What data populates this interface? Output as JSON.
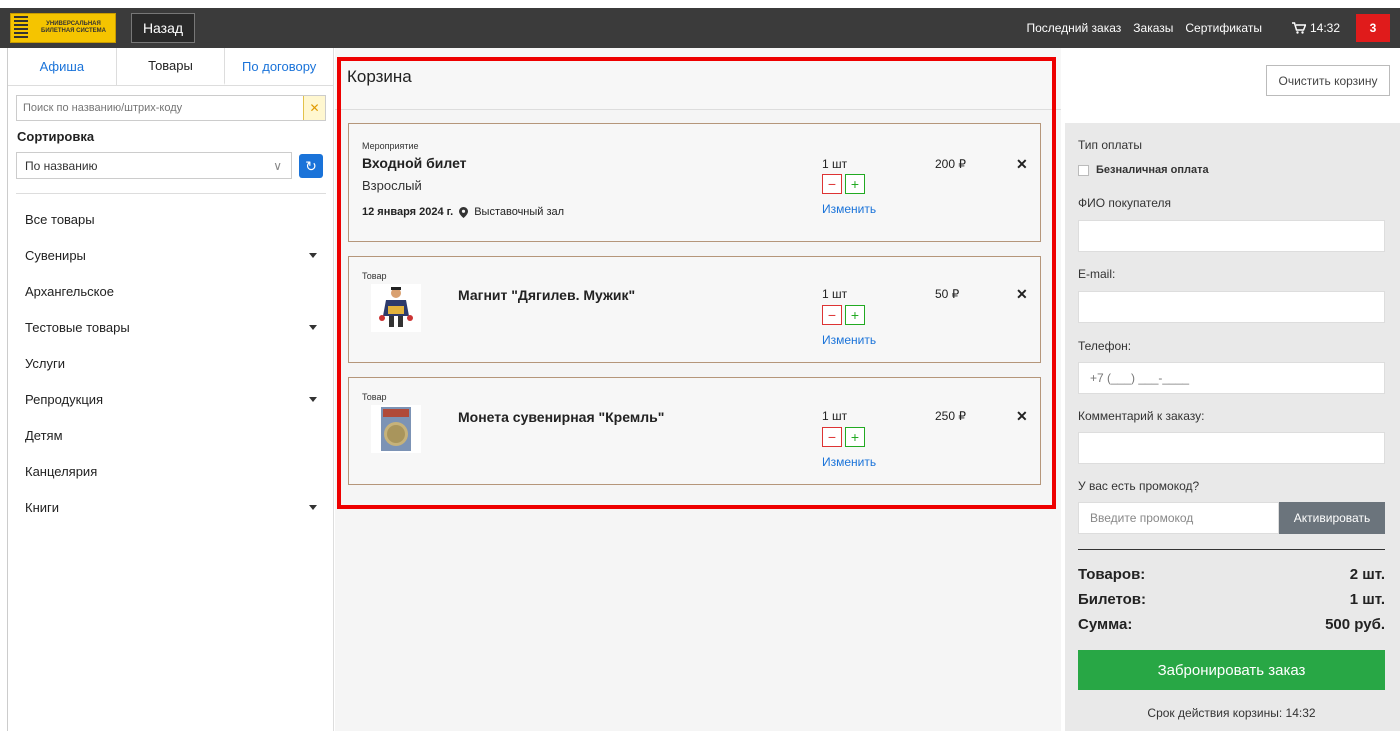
{
  "header": {
    "logo_text": "УНИВЕРСАЛЬНАЯ БИЛЕТНАЯ СИСТЕМА",
    "back_label": "Назад",
    "nav": [
      "Последний заказ",
      "Заказы",
      "Сертификаты"
    ],
    "cart_time": "14:32",
    "cart_count": "3"
  },
  "sidebar": {
    "tabs": [
      {
        "label": "Афиша"
      },
      {
        "label": "Товары"
      },
      {
        "label": "По договору"
      }
    ],
    "search_placeholder": "Поиск по названию/штрих-коду",
    "sort_label": "Сортировка",
    "sort_value": "По названию",
    "categories": [
      {
        "label": "Все товары",
        "expandable": false
      },
      {
        "label": "Сувениры",
        "expandable": true
      },
      {
        "label": "Архангельское",
        "expandable": false
      },
      {
        "label": "Тестовые товары",
        "expandable": true
      },
      {
        "label": "Услуги",
        "expandable": false
      },
      {
        "label": "Репродукция",
        "expandable": true
      },
      {
        "label": "Детям",
        "expandable": false
      },
      {
        "label": "Канцелярия",
        "expandable": false
      },
      {
        "label": "Книги",
        "expandable": true
      }
    ]
  },
  "cart": {
    "title": "Корзина",
    "items": [
      {
        "type": "Мероприятие",
        "name": "Входной билет",
        "sub": "Взрослый",
        "date": "12 января 2024 г.",
        "place": "Выставочный зал",
        "qty": "1 шт",
        "price": "200 ₽",
        "change": "Изменить"
      },
      {
        "type": "Товар",
        "name": "Магнит \"Дягилев. Мужик\"",
        "qty": "1 шт",
        "price": "50 ₽",
        "change": "Изменить"
      },
      {
        "type": "Товар",
        "name": "Монета сувенирная \"Кремль\"",
        "qty": "1 шт",
        "price": "250 ₽",
        "change": "Изменить"
      }
    ]
  },
  "checkout": {
    "clear_label": "Очистить корзину",
    "payment_label": "Тип оплаты",
    "cashless_label": "Безналичная оплата",
    "fio_label": "ФИО покупателя",
    "email_label": "E-mail:",
    "phone_label": "Телефон:",
    "phone_placeholder": "+7 (___) ___-____",
    "comment_label": "Комментарий к заказу:",
    "promo_label": "У вас есть промокод?",
    "promo_placeholder": "Введите промокод",
    "promo_button": "Активировать",
    "totals": [
      {
        "label": "Товаров:",
        "value": "2 шт."
      },
      {
        "label": "Билетов:",
        "value": "1 шт."
      },
      {
        "label": "Сумма:",
        "value": "500 руб."
      }
    ],
    "book_label": "Забронировать заказ",
    "expiry_text": "Срок действия корзины: 14:32"
  },
  "colors": {
    "accent": "#1a73d9",
    "book": "#28a745",
    "badge": "#e01b1b",
    "highlight": "#ee0000"
  }
}
